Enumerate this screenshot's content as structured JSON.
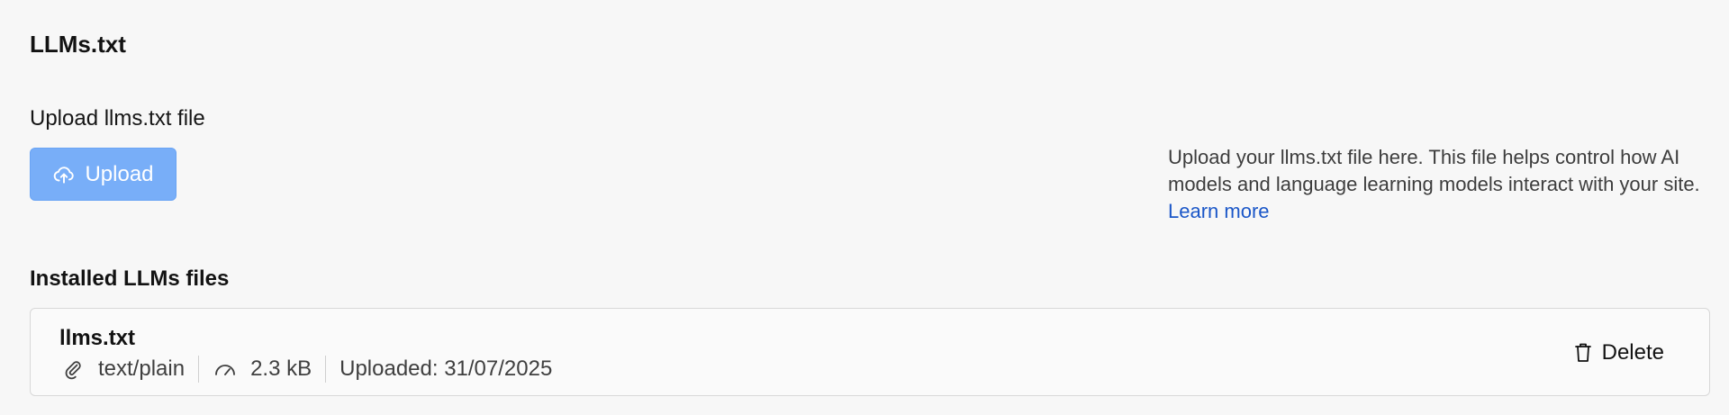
{
  "section": {
    "title": "LLMs.txt"
  },
  "upload": {
    "label": "Upload llms.txt file",
    "button_label": "Upload",
    "button_icon": "cloud-upload-icon"
  },
  "help": {
    "text": "Upload your llms.txt file here. This file helps control how AI models and language learning models interact with your site. ",
    "link_label": "Learn more"
  },
  "installed": {
    "title": "Installed LLMs files",
    "files": [
      {
        "name": "llms.txt",
        "type": "text/plain",
        "size": "2.3 kB",
        "uploaded": "Uploaded: 31/07/2025",
        "delete_label": "Delete"
      }
    ]
  },
  "colors": {
    "accent": "#78aef8",
    "link": "#1b57c8",
    "background": "#f7f7f7"
  }
}
